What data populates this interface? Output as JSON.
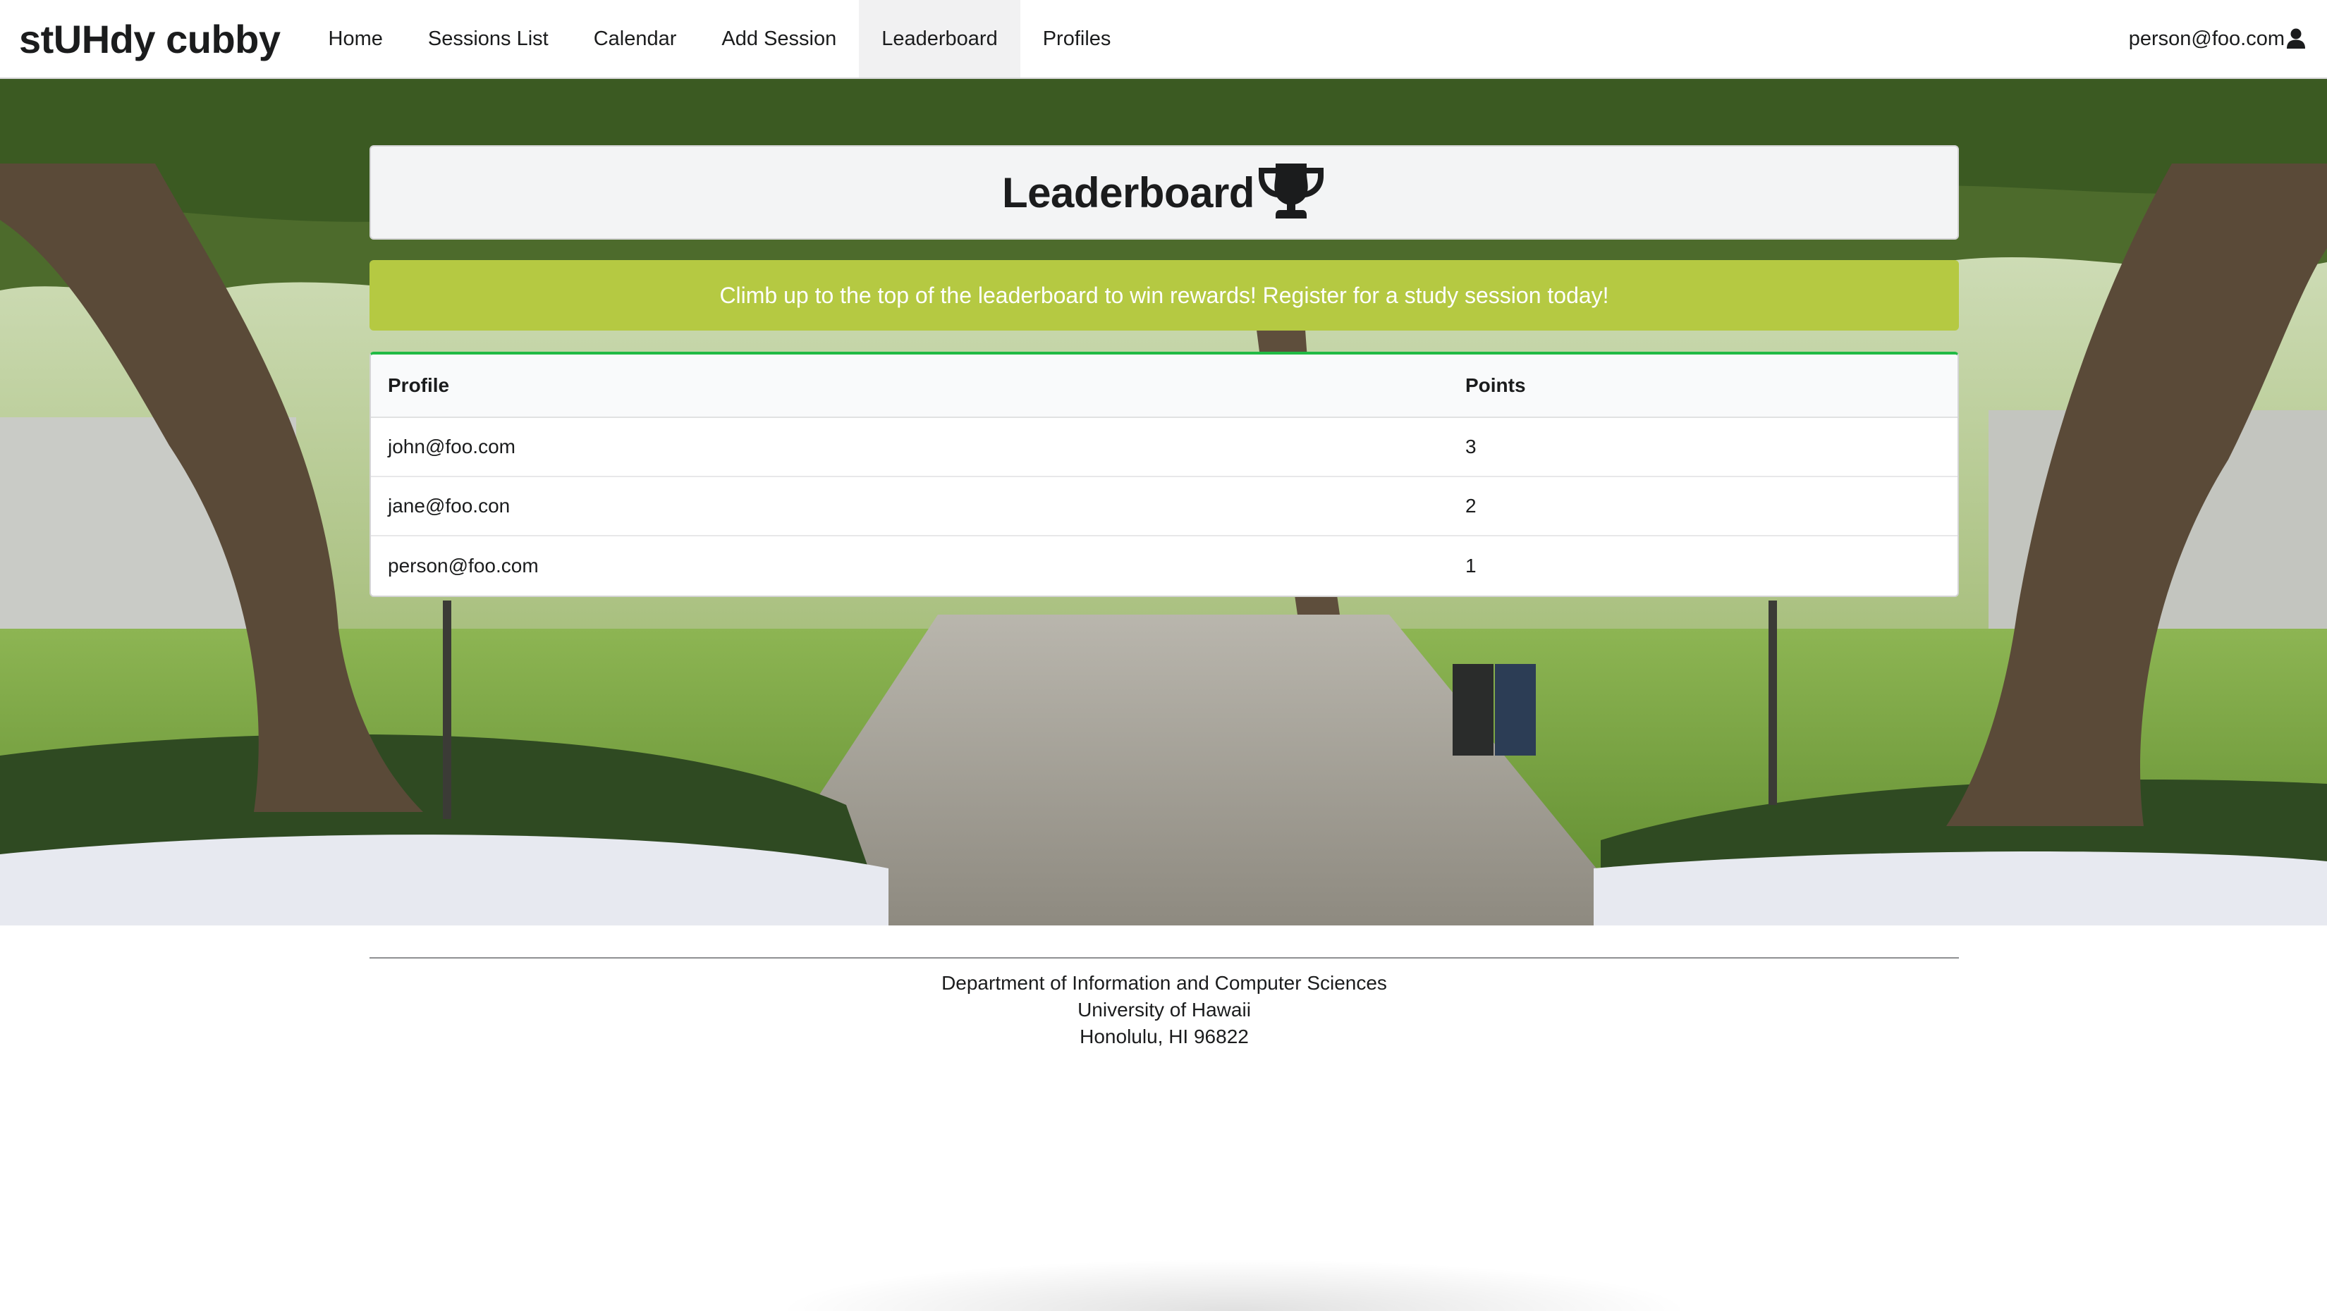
{
  "brand": "stUHdy cubby",
  "nav": {
    "items": [
      {
        "label": "Home"
      },
      {
        "label": "Sessions List"
      },
      {
        "label": "Calendar"
      },
      {
        "label": "Add Session"
      },
      {
        "label": "Leaderboard",
        "active": true
      },
      {
        "label": "Profiles"
      }
    ]
  },
  "user": {
    "email": "person@foo.com",
    "icon": "user-icon"
  },
  "header": {
    "title": "Leaderboard",
    "icon": "trophy-icon"
  },
  "banner": {
    "text": "Climb up to the top of the leaderboard to win rewards! Register for a study session today!"
  },
  "table": {
    "columns": [
      "Profile",
      "Points"
    ],
    "rows": [
      {
        "profile": "john@foo.com",
        "points": "3"
      },
      {
        "profile": "jane@foo.con",
        "points": "2"
      },
      {
        "profile": "person@foo.com",
        "points": "1"
      }
    ]
  },
  "footer": {
    "line1": "Department of Information and Computer Sciences",
    "line2": "University of Hawaii",
    "line3": "Honolulu, HI 96822"
  },
  "colors": {
    "banner": "#b5c942",
    "table_accent": "#21ba45",
    "active_nav_bg": "#f1f1f2"
  }
}
